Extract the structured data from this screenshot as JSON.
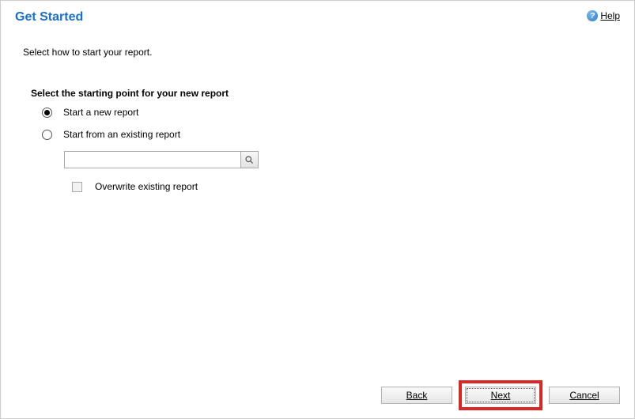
{
  "header": {
    "title": "Get Started",
    "help_label": "Help"
  },
  "subtitle": "Select how to start your report.",
  "section_label": "Select the starting point for your new report",
  "options": {
    "new_report": "Start a new report",
    "existing_report": "Start from an existing report",
    "overwrite": "Overwrite existing report"
  },
  "search": {
    "placeholder": ""
  },
  "buttons": {
    "back": "Back",
    "next": "Next",
    "cancel": "Cancel"
  }
}
